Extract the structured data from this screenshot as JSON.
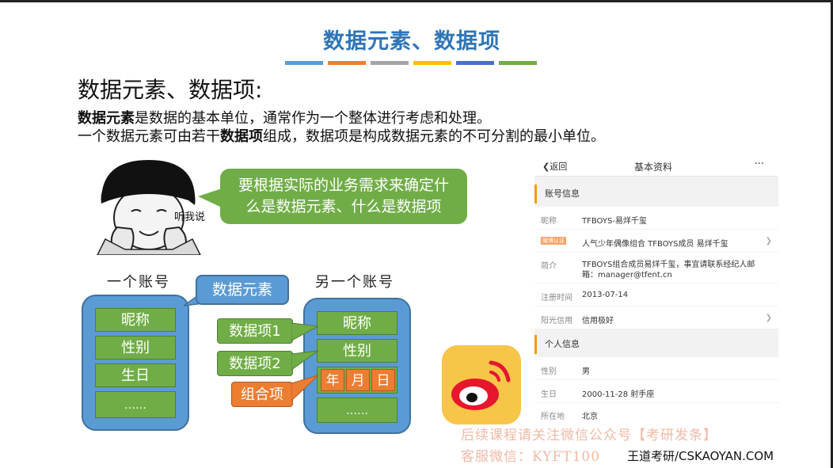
{
  "slide": {
    "title": "数据元素、数据项",
    "bar_colors": [
      "#5b9bd5",
      "#ed7d31",
      "#a5a5a5",
      "#ffc000",
      "#4472c4",
      "#70ad47"
    ],
    "heading": "数据元素、数据项:",
    "line1_bold": "数据元素",
    "line1_rest": "是数据的基本单位，通常作为一个整体进行考虑和处理。",
    "line2_a": "一个数据元素可由若干",
    "line2_bold": "数据项",
    "line2_b": "组成，数据项是构成数据元素的不可分割的最小单位。"
  },
  "meme": {
    "bubble_line1": "要根据实际的业务需求来确定什",
    "bubble_line2": "么是数据元素、什么是数据项",
    "caption": "听我说"
  },
  "diagram": {
    "left_label": "一个账号",
    "right_label": "另一个账号",
    "element_tag": "数据元素",
    "item1_tag": "数据项1",
    "item2_tag": "数据项2",
    "combo_tag": "组合项",
    "left_cells": [
      "昵称",
      "性别",
      "生日",
      "……"
    ],
    "right_cells": [
      "昵称",
      "性别",
      "……"
    ],
    "date_parts": [
      "年",
      "月",
      "日"
    ]
  },
  "profile": {
    "back": "返回",
    "title": "基本资料",
    "more": "···",
    "section1": "账号信息",
    "nick_label": "昵称",
    "nick_value": "TFBOYS-易烊千玺",
    "verify_label": "微博认证",
    "verify_value": "人气少年偶像组合 TFBOYS成员 易烊千玺",
    "intro_label": "简介",
    "intro_value1": "TFBOYS组合成员易烊千玺，事宜请联系经纪人邮",
    "intro_value2": "箱：manager@tfent.cn",
    "reg_label": "注册时间",
    "reg_value": "2013-07-14",
    "credit_label": "阳光信用",
    "credit_value": "信用极好",
    "section2": "个人信息",
    "gender_label": "性别",
    "gender_value": "男",
    "birth_label": "生日",
    "birth_value": "2000-11-28 射手座",
    "loc_label": "所在地",
    "loc_value": "北京"
  },
  "watermark": {
    "line1": "后续课程请关注微信公众号【考研发条】",
    "line2": "客服微信：KYFT100",
    "brand": "王道考研/CSKAOYAN.COM"
  }
}
